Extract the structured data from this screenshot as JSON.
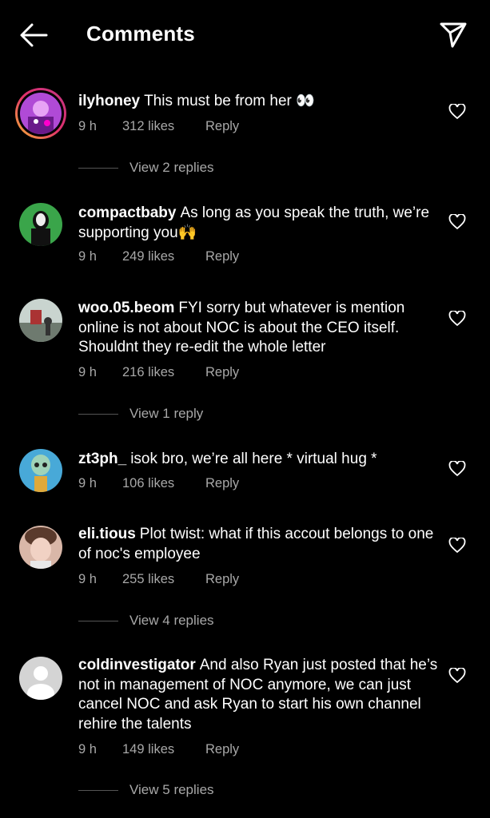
{
  "header": {
    "title": "Comments"
  },
  "comments": [
    {
      "username": "ilyhoney",
      "text": "This must be from her 👀",
      "time": "9 h",
      "likes": "312 likes",
      "reply": "Reply",
      "view_replies": "View 2 replies"
    },
    {
      "username": "compactbaby",
      "text": "As long as you speak the truth, we’re supporting you🙌",
      "time": "9 h",
      "likes": "249 likes",
      "reply": "Reply"
    },
    {
      "username": "woo.05.beom",
      "text": "FYI sorry but whatever is mention online is not about NOC is about the CEO itself. Shouldnt they re-edit the whole letter",
      "time": "9 h",
      "likes": "216 likes",
      "reply": "Reply",
      "view_replies": "View 1 reply"
    },
    {
      "username": "zt3ph_",
      "text": "isok bro, we’re all here * virtual hug *",
      "time": "9 h",
      "likes": "106 likes",
      "reply": "Reply"
    },
    {
      "username": "eli.tious",
      "text": "Plot twist: what if this accout belongs to one of noc's employee",
      "time": "9 h",
      "likes": "255 likes",
      "reply": "Reply",
      "view_replies": "View 4 replies"
    },
    {
      "username": "coldinvestigator",
      "text": "And also Ryan just posted that he’s not in management of NOC anymore, we can just cancel NOC and ask Ryan to start his own channel rehire the talents",
      "time": "9 h",
      "likes": "149 likes",
      "reply": "Reply",
      "view_replies": "View 5 replies"
    }
  ]
}
